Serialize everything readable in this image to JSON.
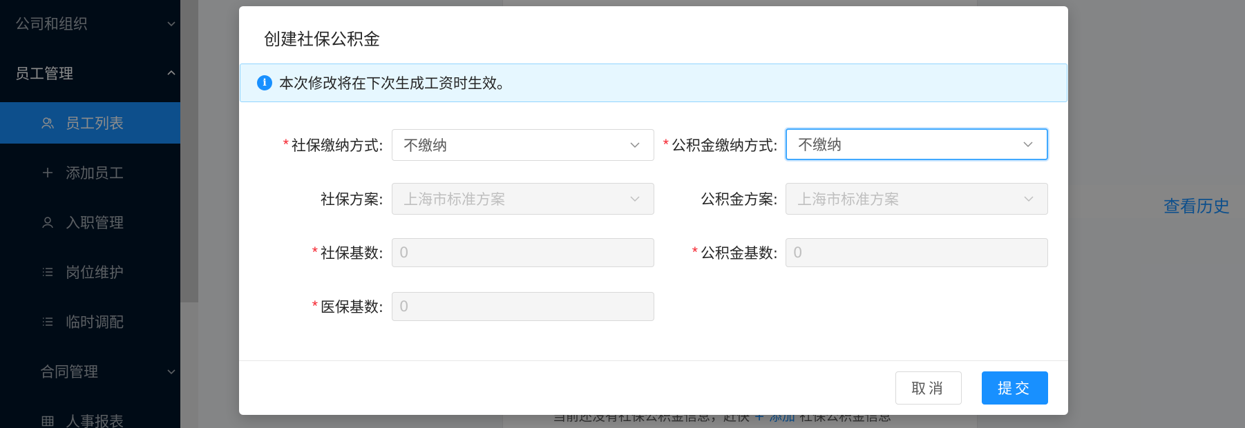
{
  "sidebar": {
    "groups": [
      {
        "label": "公司和组织",
        "expanded": false
      },
      {
        "label": "员工管理",
        "expanded": true
      }
    ],
    "items": [
      {
        "label": "员工列表",
        "icon": "team-icon",
        "active": true
      },
      {
        "label": "添加员工",
        "icon": "plus-icon",
        "active": false
      },
      {
        "label": "入职管理",
        "icon": "user-icon",
        "active": false
      },
      {
        "label": "岗位维护",
        "icon": "list-icon",
        "active": false
      },
      {
        "label": "临时调配",
        "icon": "list-icon",
        "active": false
      }
    ],
    "bottom_group": {
      "label": "合同管理",
      "expanded": false
    },
    "bottom_item": {
      "label": "人事报表",
      "icon": "table-icon"
    }
  },
  "background": {
    "history_link": "查看历史",
    "empty_msg_prefix": "当前还没有社保公积金信息，赶快",
    "empty_msg_link": "+ 添加",
    "empty_msg_suffix": "社保公积金信息"
  },
  "modal": {
    "title": "创建社保公积金",
    "alert": "本次修改将在下次生成工资时生效。",
    "fields": {
      "social_mode": {
        "label": "社保缴纳方式:",
        "value": "不缴纳",
        "required": true
      },
      "fund_mode": {
        "label": "公积金缴纳方式:",
        "value": "不缴纳",
        "required": true
      },
      "social_plan": {
        "label": "社保方案:",
        "placeholder": "上海市标准方案"
      },
      "fund_plan": {
        "label": "公积金方案:",
        "placeholder": "上海市标准方案"
      },
      "social_base": {
        "label": "社保基数:",
        "value": "0",
        "required": true
      },
      "fund_base": {
        "label": "公积金基数:",
        "value": "0",
        "required": true
      },
      "medical_base": {
        "label": "医保基数:",
        "value": "0",
        "required": true
      }
    },
    "cancel_label": "取消",
    "submit_label": "提交"
  },
  "colors": {
    "sidebar_bg": "#001529",
    "primary": "#1890ff",
    "required": "#f5222d",
    "alert_bg": "#e6f7ff"
  }
}
